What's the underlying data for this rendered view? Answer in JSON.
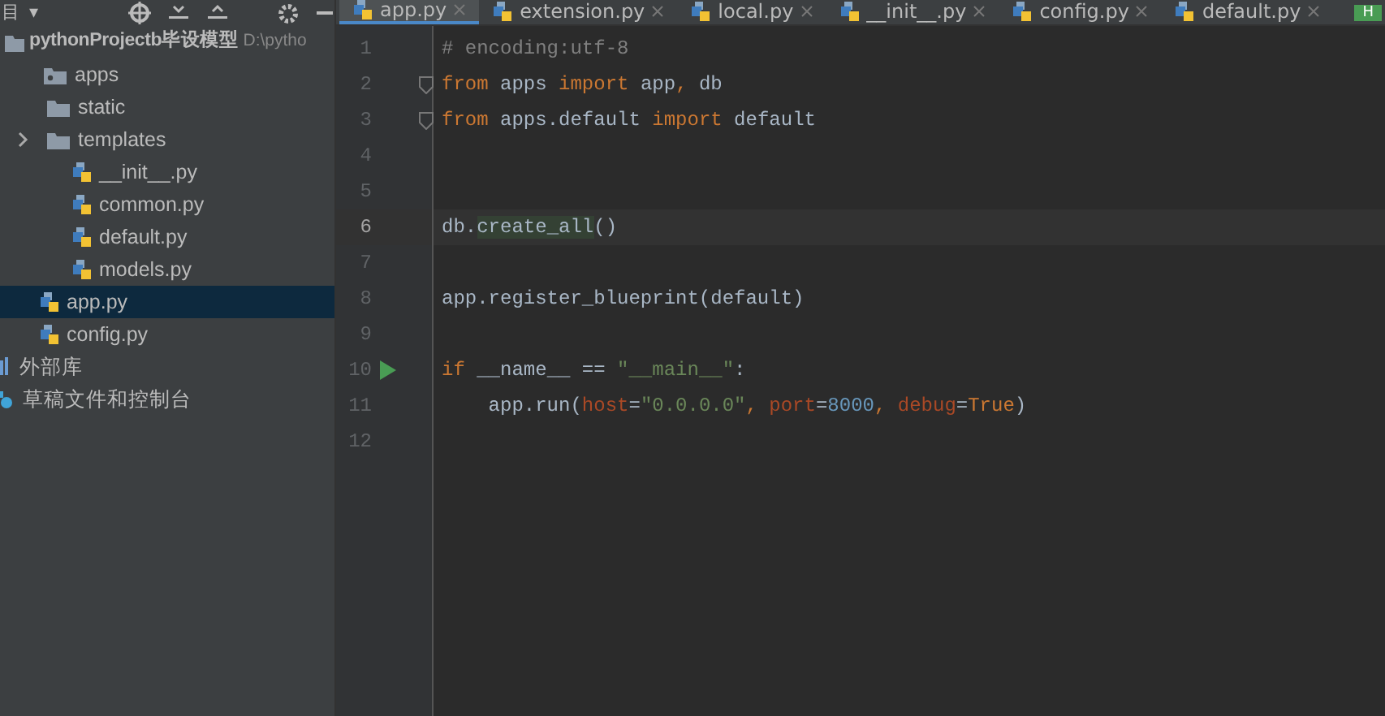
{
  "project_panel": {
    "title": "目",
    "dropdown": "▾"
  },
  "tabs": [
    {
      "label": "app.py",
      "selected": true
    },
    {
      "label": "extension.py",
      "selected": false
    },
    {
      "label": "local.py",
      "selected": false
    },
    {
      "label": "__init__.py",
      "selected": false
    },
    {
      "label": "config.py",
      "selected": false
    },
    {
      "label": "default.py",
      "selected": false
    }
  ],
  "inspection_badge": "H",
  "tree": [
    {
      "kind": "project",
      "label": "pythonProjectb毕设模型",
      "path": "D:\\pytho",
      "selected": false,
      "children": [
        {
          "kind": "package",
          "label": "apps",
          "selected": false,
          "children": [
            {
              "kind": "folder",
              "label": "static",
              "selected": false
            },
            {
              "kind": "folder",
              "label": "templates",
              "expanded": false,
              "selected": false
            },
            {
              "kind": "file",
              "label": "__init__.py",
              "selected": false
            },
            {
              "kind": "file",
              "label": "common.py",
              "selected": false
            },
            {
              "kind": "file",
              "label": "default.py",
              "selected": false
            },
            {
              "kind": "file",
              "label": "models.py",
              "selected": false
            }
          ]
        },
        {
          "kind": "file",
          "label": "app.py",
          "selected": true
        },
        {
          "kind": "file",
          "label": "config.py",
          "selected": false
        }
      ]
    },
    {
      "kind": "library",
      "label": "外部库",
      "selected": false
    },
    {
      "kind": "scratch",
      "label": "草稿文件和控制台",
      "selected": false
    }
  ],
  "editor": {
    "lines": [
      {
        "number": "1",
        "tokens": [
          {
            "kind": "comment",
            "text": "# encoding:utf-8"
          }
        ]
      },
      {
        "number": "2",
        "fold": true,
        "tokens": [
          {
            "kind": "keyword",
            "text": "from"
          },
          {
            "kind": "plain",
            "text": " apps "
          },
          {
            "kind": "keyword",
            "text": "import"
          },
          {
            "kind": "plain",
            "text": " app"
          },
          {
            "kind": "keyword",
            "text": ","
          },
          {
            "kind": "plain",
            "text": " db"
          }
        ]
      },
      {
        "number": "3",
        "fold": true,
        "tokens": [
          {
            "kind": "keyword",
            "text": "from"
          },
          {
            "kind": "plain",
            "text": " apps.default "
          },
          {
            "kind": "keyword",
            "text": "import"
          },
          {
            "kind": "plain",
            "text": " default"
          }
        ]
      },
      {
        "number": "4"
      },
      {
        "number": "5"
      },
      {
        "number": "6",
        "current": true,
        "tokens": [
          {
            "kind": "plain",
            "text": "db."
          },
          {
            "kind": "highlight",
            "text": "create_all"
          },
          {
            "kind": "plain",
            "text": "()"
          }
        ]
      },
      {
        "number": "7"
      },
      {
        "number": "8",
        "tokens": [
          {
            "kind": "plain",
            "text": "app.register_blueprint(default)"
          }
        ]
      },
      {
        "number": "9"
      },
      {
        "number": "10",
        "run": true,
        "tokens": [
          {
            "kind": "keyword",
            "text": "if"
          },
          {
            "kind": "plain",
            "text": " __name__ == "
          },
          {
            "kind": "string",
            "text": "\"__main__\""
          },
          {
            "kind": "plain",
            "text": ":"
          }
        ]
      },
      {
        "number": "11",
        "tokens": [
          {
            "kind": "plain",
            "text": "    app.run("
          },
          {
            "kind": "param",
            "text": "host"
          },
          {
            "kind": "plain",
            "text": "="
          },
          {
            "kind": "string",
            "text": "\"0.0.0.0\""
          },
          {
            "kind": "keyword",
            "text": ", "
          },
          {
            "kind": "param",
            "text": "port"
          },
          {
            "kind": "plain",
            "text": "="
          },
          {
            "kind": "number",
            "text": "8000"
          },
          {
            "kind": "keyword",
            "text": ", "
          },
          {
            "kind": "param",
            "text": "debug"
          },
          {
            "kind": "plain",
            "text": "="
          },
          {
            "kind": "keyword",
            "text": "True"
          },
          {
            "kind": "plain",
            "text": ")"
          }
        ]
      },
      {
        "number": "12"
      }
    ]
  }
}
